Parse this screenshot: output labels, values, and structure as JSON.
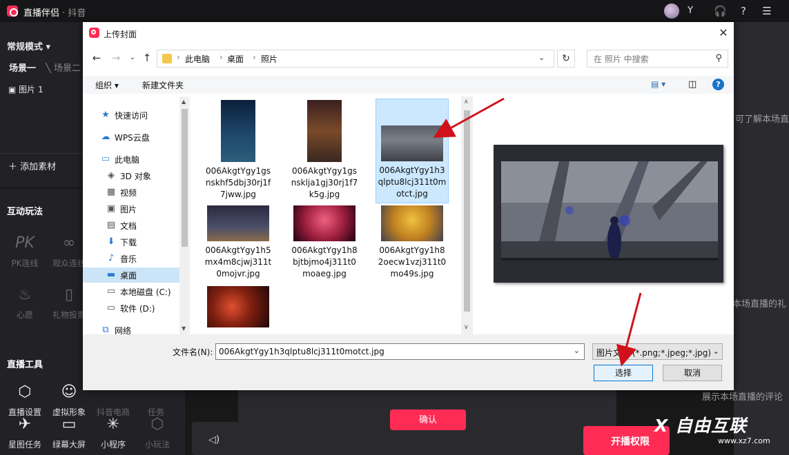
{
  "app": {
    "title": "直播伴侣",
    "subtitle": "· 抖音",
    "username": "Y"
  },
  "left": {
    "mode": "常规模式",
    "scene_tabs": [
      "场景一",
      "场景二"
    ],
    "source_item": "图片 1",
    "add_material": "添加素材",
    "interactive_title": "互动玩法",
    "interactive": [
      "PK连线",
      "观众连线",
      "心愿",
      "礼物投票"
    ],
    "tools_title": "直播工具",
    "tools": [
      "直播设置",
      "虚拟形象",
      "抖音电商",
      "任务"
    ],
    "bottom_tools": [
      "星图任务",
      "绿幕大屏",
      "小程序",
      "小玩法"
    ]
  },
  "right": {
    "hint1": "可了解本场直",
    "hint2": "本场直播的礼",
    "hint3": "展示本场直播的评论"
  },
  "confirm_label": "确认",
  "permission_label": "开播权限",
  "dialog": {
    "title": "上传封面",
    "breadcrumbs": [
      "此电脑",
      "桌面",
      "照片"
    ],
    "search_placeholder": "在 照片 中搜索",
    "organize": "组织",
    "new_folder": "新建文件夹",
    "nav_items": [
      {
        "label": "快速访问",
        "icon": "star-icon"
      },
      {
        "label": "WPS云盘",
        "icon": "cloud-icon"
      },
      {
        "label": "此电脑",
        "icon": "computer-icon"
      },
      {
        "label": "3D 对象",
        "icon": "cube-icon"
      },
      {
        "label": "视频",
        "icon": "video-icon"
      },
      {
        "label": "图片",
        "icon": "image-icon"
      },
      {
        "label": "文档",
        "icon": "document-icon"
      },
      {
        "label": "下载",
        "icon": "download-icon"
      },
      {
        "label": "音乐",
        "icon": "music-icon"
      },
      {
        "label": "桌面",
        "icon": "desktop-icon"
      },
      {
        "label": "本地磁盘 (C:)",
        "icon": "drive-icon"
      },
      {
        "label": "软件 (D:)",
        "icon": "drive-icon"
      },
      {
        "label": "网络",
        "icon": "network-icon"
      }
    ],
    "files": [
      {
        "name_lines": [
          "006AkgtYgy1gs",
          "nskhf5dbj30rj1f",
          "7jww.jpg"
        ]
      },
      {
        "name_lines": [
          "006AkgtYgy1gs",
          "nsklja1gj30rj1f7",
          "k5g.jpg"
        ]
      },
      {
        "name_lines": [
          "006AkgtYgy1h3",
          "qlptu8lcj311t0m",
          "otct.jpg"
        ]
      },
      {
        "name_lines": [
          "006AkgtYgy1h5",
          "mx4m8cjwj311t",
          "0mojvr.jpg"
        ]
      },
      {
        "name_lines": [
          "006AkgtYgy1h8",
          "bjtbjmo4j311t0",
          "moaeg.jpg"
        ]
      },
      {
        "name_lines": [
          "006AkgtYgy1h8",
          "2oecw1vzj311t0",
          "mo49s.jpg"
        ]
      },
      {
        "name_lines": []
      }
    ],
    "filename_label": "文件名(N):",
    "filename_value": "006AkgtYgy1h3qlptu8lcj311t0motct.jpg",
    "filter_value": "图片文件 (*.png;*.jpeg;*.jpg)",
    "select_label": "选择",
    "cancel_label": "取消"
  },
  "watermark": {
    "brand": "X 自由互联",
    "site": "www.xz7.com"
  },
  "colors": {
    "accent": "#fe2c55",
    "selection": "#cce8ff",
    "arrow": "#d0111b"
  }
}
